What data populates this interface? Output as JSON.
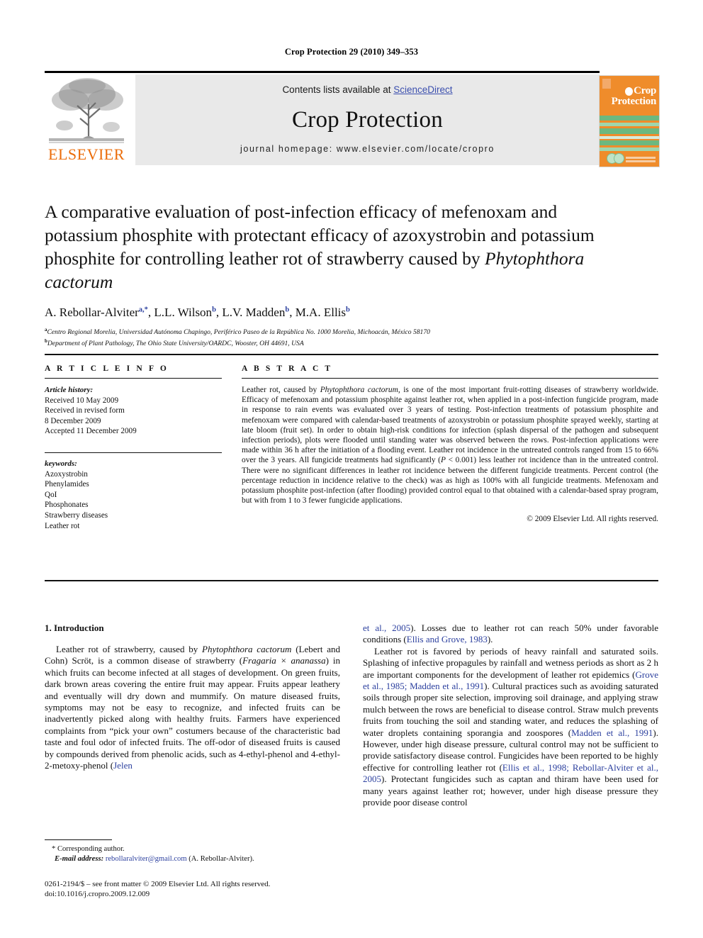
{
  "running_head": "Crop Protection 29 (2010) 349–353",
  "masthead": {
    "contents_prefix": "Contents lists available at ",
    "sciencedirect": "ScienceDirect",
    "journal_title": "Crop Protection",
    "homepage": "journal homepage: www.elsevier.com/locate/cropro",
    "publisher_wordmark": "ELSEVIER",
    "cover_title_line1": "Crop",
    "cover_title_line2": "Protection",
    "colors": {
      "link_blue": "#3b4fae",
      "elsevier_orange": "#eb6c09",
      "cover_orange": "#ef8c2b",
      "cover_green": "#6cb87f",
      "banner_grey": "#e9e9e9"
    }
  },
  "article": {
    "title_part1": "A comparative evaluation of post-infection efficacy of mefenoxam and potassium phosphite with protectant efficacy of azoxystrobin and potassium phosphite for controlling leather rot of strawberry caused by ",
    "title_italic": "Phytophthora cactorum",
    "authors": [
      {
        "name": "A. Rebollar-Alviter",
        "sup": "a,*"
      },
      {
        "name": "L.L. Wilson",
        "sup": "b"
      },
      {
        "name": "L.V. Madden",
        "sup": "b"
      },
      {
        "name": "M.A. Ellis",
        "sup": "b"
      }
    ],
    "affiliations": [
      {
        "mark": "a",
        "text": "Centro Regional Morelia, Universidad Autónoma Chapingo, Periférico Paseo de la República No. 1000 Morelia, Michoacán, México 58170"
      },
      {
        "mark": "b",
        "text": "Department of Plant Pathology, The Ohio State University/OARDC, Wooster, OH 44691, USA"
      }
    ]
  },
  "article_info": {
    "heading": "A R T I C L E  I N F O",
    "history_label": "Article history:",
    "history_lines": [
      "Received 10 May 2009",
      "Received in revised form",
      "8 December 2009",
      "Accepted 11 December 2009"
    ],
    "keywords_label": "keywords:",
    "keywords": [
      "Azoxystrobin",
      "Phenylamides",
      "QoI",
      "Phosphonates",
      "Strawberry diseases",
      "Leather rot"
    ]
  },
  "abstract": {
    "heading": "A B S T R A C T",
    "text_1": "Leather rot, caused by ",
    "species": "Phytophthora cactorum",
    "text_2": ", is one of the most important fruit-rotting diseases of strawberry worldwide. Efficacy of mefenoxam and potassium phosphite against leather rot, when applied in a post-infection fungicide program, made in response to rain events was evaluated over 3 years of testing. Post-infection treatments of potassium phosphite and mefenoxam were compared with calendar-based treatments of azoxystrobin or potassium phosphite sprayed weekly, starting at late bloom (fruit set). In order to obtain high-risk conditions for infection (splash dispersal of the pathogen and subsequent infection periods), plots were flooded until standing water was observed between the rows. Post-infection applications were made within 36 h after the initiation of a flooding event. Leather rot incidence in the untreated controls ranged from 15 to 66% over the 3 years. All fungicide treatments had significantly (",
    "pval_italic": "P",
    "text_3": " < 0.001) less leather rot incidence than in the untreated control. There were no significant differences in leather rot incidence between the different fungicide treatments. Percent control (the percentage reduction in incidence relative to the check) was as high as 100% with all fungicide treatments. Mefenoxam and potassium phosphite post-infection (after flooding) provided control equal to that obtained with a calendar-based spray program, but with from 1 to 3 fewer fungicide applications.",
    "copyright": "© 2009 Elsevier Ltd. All rights reserved."
  },
  "body": {
    "section_heading": "1. Introduction",
    "left_p1_a": "Leather rot of strawberry, caused by ",
    "left_p1_sp1": "Phytophthora cactorum",
    "left_p1_b": " (Lebert and Cohn) Scröt, is a common disease of strawberry (",
    "left_p1_sp2": "Fragaria × ananassa",
    "left_p1_c": ") in which fruits can become infected at all stages of development. On green fruits, dark brown areas covering the entire fruit may appear. Fruits appear leathery and eventually will dry down and mummify. On mature diseased fruits, symptoms may not be easy to recognize, and infected fruits can be inadvertently picked along with healthy fruits. Farmers have experienced complaints from “pick your own” costumers because of the characteristic bad taste and foul odor of infected fruits. The off-odor of diseased fruits is caused by compounds derived from phenolic acids, such as 4-ethyl-phenol and 4-ethyl-2-metoxy-phenol (",
    "left_p1_ref": "Jelen",
    "right_p1_ref": "et al., 2005",
    "right_p1_a": "). Losses due to leather rot can reach 50% under favorable conditions (",
    "right_p1_ref2": "Ellis and Grove, 1983",
    "right_p1_b": ").",
    "right_p2_a": "Leather rot is favored by periods of heavy rainfall and saturated soils. Splashing of infective propagules by rainfall and wetness periods as short as 2 h are important components for the development of leather rot epidemics (",
    "right_p2_ref1": "Grove et al., 1985; Madden et al., 1991",
    "right_p2_b": "). Cultural practices such as avoiding saturated soils through proper site selection, improving soil drainage, and applying straw mulch between the rows are beneficial to disease control. Straw mulch prevents fruits from touching the soil and standing water, and reduces the splashing of water droplets containing sporangia and zoospores (",
    "right_p2_ref2": "Madden et al., 1991",
    "right_p2_c": "). However, under high disease pressure, cultural control may not be sufficient to provide satisfactory disease control. Fungicides have been reported to be highly effective for controlling leather rot (",
    "right_p2_ref3": "Ellis et al., 1998; Rebollar-Alviter et al., 2005",
    "right_p2_d": "). Protectant fungicides such as captan and thiram have been used for many years against leather rot; however, under high disease pressure they provide poor disease control"
  },
  "footnotes": {
    "corresponding": "* Corresponding author.",
    "email_label": "E-mail address:",
    "email": "rebollaralviter@gmail.com",
    "email_suffix": " (A. Rebollar-Alviter)."
  },
  "footer": {
    "legal": "0261-2194/$ – see front matter © 2009 Elsevier Ltd. All rights reserved.",
    "doi": "doi:10.1016/j.cropro.2009.12.009"
  }
}
